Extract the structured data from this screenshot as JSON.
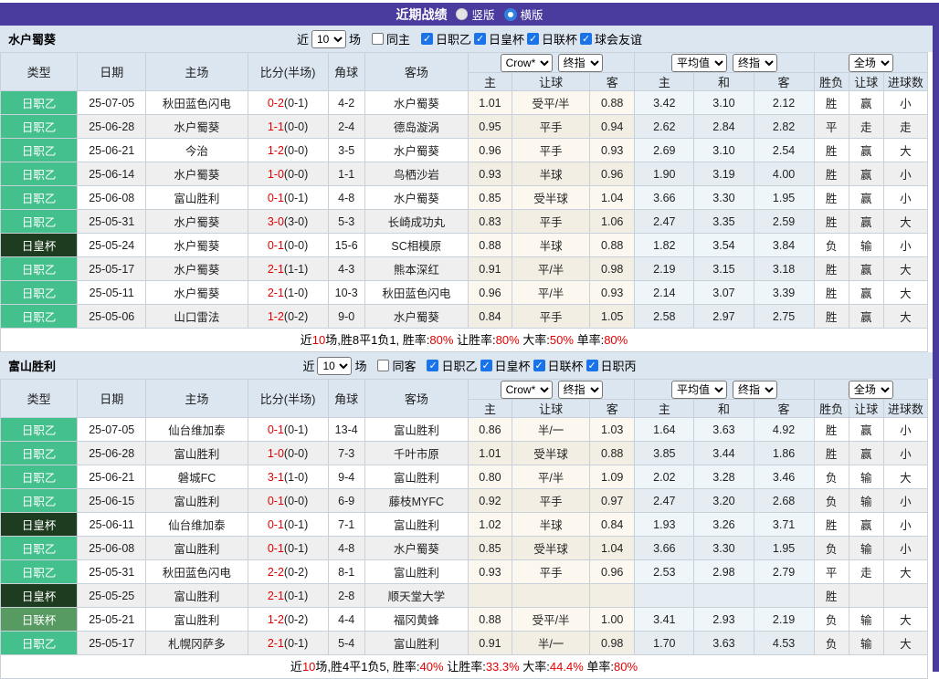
{
  "title_bar": {
    "title": "近期战绩",
    "radio_vertical": "竖版",
    "radio_horizontal": "横版",
    "selected_layout": "横版"
  },
  "colors": {
    "accent": "#4a3b9f",
    "header_bg": "#dce6f1",
    "focus_team": "#22a832",
    "win_red": "#e10000",
    "lose_blue": "#2323cc",
    "draw_green": "#149414",
    "league": {
      "日职乙": "#44c08c",
      "日皇杯": "#1e3c20",
      "日联杯": "#579b62"
    }
  },
  "cols": {
    "left": [
      "类型",
      "日期",
      "主场",
      "比分(半场)",
      "角球",
      "客场"
    ],
    "sub": [
      "主",
      "让球",
      "客",
      "主",
      "和",
      "客",
      "胜负",
      "让球",
      "进球数"
    ]
  },
  "selectors": {
    "crow": "Crow*",
    "final": "终指",
    "avg": "平均值",
    "full": "全场"
  },
  "sections": [
    {
      "team": "水户蜀葵",
      "filter": {
        "near_label": "近",
        "count": "10",
        "games_label": "场",
        "same_label": "同主",
        "same_checked": false,
        "leagues": [
          "日职乙",
          "日皇杯",
          "日联杯",
          "球会友谊"
        ]
      },
      "rows": [
        {
          "type": "日职乙",
          "date": "25-07-05",
          "home": "秋田蓝色闪电",
          "home_focus": false,
          "score": "0-2",
          "half": "(0-1)",
          "corner": "4-2",
          "away": "水户蜀葵",
          "away_focus": true,
          "crow": [
            "1.01",
            "受平/半",
            "0.88"
          ],
          "avg": [
            "3.42",
            "3.10",
            "2.12"
          ],
          "result": [
            [
              "胜",
              "r"
            ],
            [
              "赢",
              "r"
            ],
            [
              "小",
              "b"
            ]
          ]
        },
        {
          "type": "日职乙",
          "date": "25-06-28",
          "home": "水户蜀葵",
          "home_focus": true,
          "score": "1-1",
          "half": "(0-0)",
          "corner": "2-4",
          "away": "德岛漩涡",
          "away_focus": false,
          "crow": [
            "0.95",
            "平手",
            "0.94"
          ],
          "avg": [
            "2.62",
            "2.84",
            "2.82"
          ],
          "result": [
            [
              "平",
              "g"
            ],
            [
              "走",
              "g"
            ],
            [
              "走",
              "g"
            ]
          ]
        },
        {
          "type": "日职乙",
          "date": "25-06-21",
          "home": "今治",
          "home_focus": false,
          "score": "1-2",
          "half": "(0-0)",
          "corner": "3-5",
          "away": "水户蜀葵",
          "away_focus": true,
          "crow": [
            "0.96",
            "平手",
            "0.93"
          ],
          "avg": [
            "2.69",
            "3.10",
            "2.54"
          ],
          "result": [
            [
              "胜",
              "r"
            ],
            [
              "赢",
              "r"
            ],
            [
              "大",
              "r"
            ]
          ]
        },
        {
          "type": "日职乙",
          "date": "25-06-14",
          "home": "水户蜀葵",
          "home_focus": true,
          "score": "1-0",
          "half": "(0-0)",
          "corner": "1-1",
          "away": "鸟栖沙岩",
          "away_focus": false,
          "crow": [
            "0.93",
            "半球",
            "0.96"
          ],
          "avg": [
            "1.90",
            "3.19",
            "4.00"
          ],
          "result": [
            [
              "胜",
              "r"
            ],
            [
              "赢",
              "r"
            ],
            [
              "小",
              "b"
            ]
          ]
        },
        {
          "type": "日职乙",
          "date": "25-06-08",
          "home": "富山胜利",
          "home_focus": false,
          "score": "0-1",
          "half": "(0-1)",
          "corner": "4-8",
          "away": "水户蜀葵",
          "away_focus": true,
          "crow": [
            "0.85",
            "受半球",
            "1.04"
          ],
          "avg": [
            "3.66",
            "3.30",
            "1.95"
          ],
          "result": [
            [
              "胜",
              "r"
            ],
            [
              "赢",
              "r"
            ],
            [
              "小",
              "b"
            ]
          ]
        },
        {
          "type": "日职乙",
          "date": "25-05-31",
          "home": "水户蜀葵",
          "home_focus": true,
          "score": "3-0",
          "half": "(3-0)",
          "corner": "5-3",
          "away": "长崎成功丸",
          "away_focus": false,
          "crow": [
            "0.83",
            "平手",
            "1.06"
          ],
          "avg": [
            "2.47",
            "3.35",
            "2.59"
          ],
          "result": [
            [
              "胜",
              "r"
            ],
            [
              "赢",
              "r"
            ],
            [
              "大",
              "r"
            ]
          ]
        },
        {
          "type": "日皇杯",
          "date": "25-05-24",
          "home": "水户蜀葵",
          "home_focus": true,
          "score": "0-1",
          "half": "(0-0)",
          "corner": "15-6",
          "away": "SC相模原",
          "away_focus": false,
          "crow": [
            "0.88",
            "半球",
            "0.88"
          ],
          "avg": [
            "1.82",
            "3.54",
            "3.84"
          ],
          "result": [
            [
              "负",
              "b"
            ],
            [
              "输",
              "b"
            ],
            [
              "小",
              "b"
            ]
          ]
        },
        {
          "type": "日职乙",
          "date": "25-05-17",
          "home": "水户蜀葵",
          "home_focus": true,
          "score": "2-1",
          "half": "(1-1)",
          "corner": "4-3",
          "away": "熊本深红",
          "away_focus": false,
          "crow": [
            "0.91",
            "平/半",
            "0.98"
          ],
          "avg": [
            "2.19",
            "3.15",
            "3.18"
          ],
          "result": [
            [
              "胜",
              "r"
            ],
            [
              "赢",
              "r"
            ],
            [
              "大",
              "r"
            ]
          ]
        },
        {
          "type": "日职乙",
          "date": "25-05-11",
          "home": "水户蜀葵",
          "home_focus": true,
          "score": "2-1",
          "half": "(1-0)",
          "corner": "10-3",
          "away": "秋田蓝色闪电",
          "away_focus": false,
          "crow": [
            "0.96",
            "平/半",
            "0.93"
          ],
          "avg": [
            "2.14",
            "3.07",
            "3.39"
          ],
          "result": [
            [
              "胜",
              "r"
            ],
            [
              "赢",
              "r"
            ],
            [
              "大",
              "r"
            ]
          ]
        },
        {
          "type": "日职乙",
          "date": "25-05-06",
          "home": "山口雷法",
          "home_focus": false,
          "score": "1-2",
          "half": "(0-2)",
          "corner": "9-0",
          "away": "水户蜀葵",
          "away_focus": true,
          "crow": [
            "0.84",
            "平手",
            "1.05"
          ],
          "avg": [
            "2.58",
            "2.97",
            "2.75"
          ],
          "result": [
            [
              "胜",
              "r"
            ],
            [
              "赢",
              "r"
            ],
            [
              "大",
              "r"
            ]
          ]
        }
      ],
      "summary": [
        [
          "近",
          "k"
        ],
        [
          "10",
          "r"
        ],
        [
          "场,胜8平1负1, 胜率:",
          "k"
        ],
        [
          "80%",
          "r"
        ],
        [
          " 让胜率:",
          "k"
        ],
        [
          "80%",
          "r"
        ],
        [
          " 大率:",
          "k"
        ],
        [
          "50%",
          "r"
        ],
        [
          " 单率:",
          "k"
        ],
        [
          "80%",
          "r"
        ]
      ]
    },
    {
      "team": "富山胜利",
      "filter": {
        "near_label": "近",
        "count": "10",
        "games_label": "场",
        "same_label": "同客",
        "same_checked": false,
        "leagues": [
          "日职乙",
          "日皇杯",
          "日联杯",
          "日职丙"
        ]
      },
      "rows": [
        {
          "type": "日职乙",
          "date": "25-07-05",
          "home": "仙台维加泰",
          "home_focus": false,
          "score": "0-1",
          "half": "(0-1)",
          "corner": "13-4",
          "away": "富山胜利",
          "away_focus": true,
          "crow": [
            "0.86",
            "半/一",
            "1.03"
          ],
          "avg": [
            "1.64",
            "3.63",
            "4.92"
          ],
          "result": [
            [
              "胜",
              "r"
            ],
            [
              "赢",
              "r"
            ],
            [
              "小",
              "b"
            ]
          ]
        },
        {
          "type": "日职乙",
          "date": "25-06-28",
          "home": "富山胜利",
          "home_focus": true,
          "score": "1-0",
          "half": "(0-0)",
          "corner": "7-3",
          "away": "千叶市原",
          "away_focus": false,
          "crow": [
            "1.01",
            "受半球",
            "0.88"
          ],
          "avg": [
            "3.85",
            "3.44",
            "1.86"
          ],
          "result": [
            [
              "胜",
              "r"
            ],
            [
              "赢",
              "r"
            ],
            [
              "小",
              "b"
            ]
          ]
        },
        {
          "type": "日职乙",
          "date": "25-06-21",
          "home": "磐城FC",
          "home_focus": false,
          "score": "3-1",
          "half": "(1-0)",
          "corner": "9-4",
          "away": "富山胜利",
          "away_focus": true,
          "crow": [
            "0.80",
            "平/半",
            "1.09"
          ],
          "avg": [
            "2.02",
            "3.28",
            "3.46"
          ],
          "result": [
            [
              "负",
              "b"
            ],
            [
              "输",
              "b"
            ],
            [
              "大",
              "r"
            ]
          ]
        },
        {
          "type": "日职乙",
          "date": "25-06-15",
          "home": "富山胜利",
          "home_focus": true,
          "score": "0-1",
          "half": "(0-0)",
          "corner": "6-9",
          "away": "藤枝MYFC",
          "away_focus": false,
          "crow": [
            "0.92",
            "平手",
            "0.97"
          ],
          "avg": [
            "2.47",
            "3.20",
            "2.68"
          ],
          "result": [
            [
              "负",
              "b"
            ],
            [
              "输",
              "b"
            ],
            [
              "小",
              "b"
            ]
          ]
        },
        {
          "type": "日皇杯",
          "date": "25-06-11",
          "home": "仙台维加泰",
          "home_focus": false,
          "score": "0-1",
          "half": "(0-1)",
          "corner": "7-1",
          "away": "富山胜利",
          "away_focus": true,
          "crow": [
            "1.02",
            "半球",
            "0.84"
          ],
          "avg": [
            "1.93",
            "3.26",
            "3.71"
          ],
          "result": [
            [
              "胜",
              "r"
            ],
            [
              "赢",
              "r"
            ],
            [
              "小",
              "b"
            ]
          ]
        },
        {
          "type": "日职乙",
          "date": "25-06-08",
          "home": "富山胜利",
          "home_focus": true,
          "score": "0-1",
          "half": "(0-1)",
          "corner": "4-8",
          "away": "水户蜀葵",
          "away_focus": false,
          "crow": [
            "0.85",
            "受半球",
            "1.04"
          ],
          "avg": [
            "3.66",
            "3.30",
            "1.95"
          ],
          "result": [
            [
              "负",
              "b"
            ],
            [
              "输",
              "b"
            ],
            [
              "小",
              "b"
            ]
          ]
        },
        {
          "type": "日职乙",
          "date": "25-05-31",
          "home": "秋田蓝色闪电",
          "home_focus": false,
          "score": "2-2",
          "half": "(0-2)",
          "corner": "8-1",
          "away": "富山胜利",
          "away_focus": true,
          "crow": [
            "0.93",
            "平手",
            "0.96"
          ],
          "avg": [
            "2.53",
            "2.98",
            "2.79"
          ],
          "result": [
            [
              "平",
              "g"
            ],
            [
              "走",
              "g"
            ],
            [
              "大",
              "r"
            ]
          ]
        },
        {
          "type": "日皇杯",
          "date": "25-05-25",
          "home": "富山胜利",
          "home_focus": true,
          "score": "2-1",
          "half": "(0-1)",
          "corner": "2-8",
          "away": "顺天堂大学",
          "away_focus": false,
          "crow": [
            "",
            "",
            ""
          ],
          "avg": [
            "",
            "",
            ""
          ],
          "result": [
            [
              "胜",
              "r"
            ],
            [
              "",
              ""
            ],
            [
              "",
              ""
            ]
          ]
        },
        {
          "type": "日联杯",
          "date": "25-05-21",
          "home": "富山胜利",
          "home_focus": true,
          "score": "1-2",
          "half": "(0-2)",
          "corner": "4-4",
          "away": "福冈黄蜂",
          "away_focus": false,
          "crow": [
            "0.88",
            "受平/半",
            "1.00"
          ],
          "avg": [
            "3.41",
            "2.93",
            "2.19"
          ],
          "result": [
            [
              "负",
              "b"
            ],
            [
              "输",
              "b"
            ],
            [
              "大",
              "r"
            ]
          ]
        },
        {
          "type": "日职乙",
          "date": "25-05-17",
          "home": "札幌冈萨多",
          "home_focus": false,
          "score": "2-1",
          "half": "(0-1)",
          "corner": "5-4",
          "away": "富山胜利",
          "away_focus": true,
          "crow": [
            "0.91",
            "半/一",
            "0.98"
          ],
          "avg": [
            "1.70",
            "3.63",
            "4.53"
          ],
          "result": [
            [
              "负",
              "b"
            ],
            [
              "输",
              "b"
            ],
            [
              "大",
              "r"
            ]
          ]
        }
      ],
      "summary": [
        [
          "近",
          "k"
        ],
        [
          "10",
          "r"
        ],
        [
          "场,胜4平1负5, 胜率:",
          "k"
        ],
        [
          "40%",
          "r"
        ],
        [
          " 让胜率:",
          "k"
        ],
        [
          "33.3%",
          "r"
        ],
        [
          " 大率:",
          "k"
        ],
        [
          "44.4%",
          "r"
        ],
        [
          " 单率:",
          "k"
        ],
        [
          "80%",
          "r"
        ]
      ]
    }
  ]
}
